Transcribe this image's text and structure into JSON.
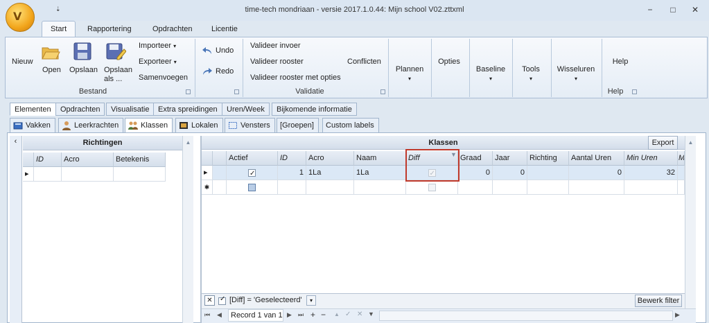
{
  "window": {
    "title": "time-tech mondriaan - versie 2017.1.0.44: Mijn school V02.zttxml",
    "min": "−",
    "max": "□",
    "close": "✕",
    "qa": "⇣"
  },
  "ribbon_tabs": [
    "Start",
    "Rapportering",
    "Opdrachten",
    "Licentie"
  ],
  "ribbon": {
    "nieuw": "Nieuw",
    "open": "Open",
    "opslaan": "Opslaan",
    "opslaan_als": "Opslaan als ...",
    "importeer": "Importeer",
    "exporteer": "Exporteer",
    "samenvoegen": "Samenvoegen",
    "bestand": "Bestand",
    "undo": "Undo",
    "redo": "Redo",
    "valideer_invoer": "Valideer invoer",
    "valideer_rooster": "Valideer rooster",
    "valideer_rooster_opties": "Valideer rooster met opties",
    "conflicten": "Conflicten",
    "validatie": "Validatie",
    "plannen": "Plannen",
    "opties": "Opties",
    "baseline": "Baseline",
    "tools": "Tools",
    "wisseluren": "Wisseluren",
    "help": "Help",
    "help_group": "Help"
  },
  "element_tabs": [
    "Elementen",
    "Opdrachten",
    "Visualisatie",
    "Extra spreidingen",
    "Uren/Week",
    "Bijkomende informatie"
  ],
  "sub_tabs": [
    "Vakken",
    "Leerkrachten",
    "Klassen",
    "Lokalen",
    "Vensters",
    "[Groepen]",
    "Custom labels"
  ],
  "richtingen": {
    "title": "Richtingen",
    "columns": [
      "ID",
      "Acro",
      "Betekenis"
    ]
  },
  "klassen": {
    "title": "Klassen",
    "export": "Export",
    "columns": [
      "Actief",
      "ID",
      "Acro",
      "Naam",
      "Diff",
      "Graad",
      "Jaar",
      "Richting",
      "Aantal Uren",
      "Min Uren",
      "M"
    ],
    "row": {
      "actief": true,
      "id": "1",
      "acro": "1La",
      "naam": "1La",
      "diff": true,
      "graad": "0",
      "jaar": "0",
      "richting": "",
      "aantal_uren": "0",
      "min_uren": "32"
    },
    "filter_text": "[Diff] = 'Geselecteerd'",
    "bewerk_filter": "Bewerk filter",
    "record_text": "Record 1 van 1"
  },
  "colors": {
    "accent": "#c0392b",
    "header": "#d5dfeb",
    "selected_row": "#dbe8f6"
  }
}
